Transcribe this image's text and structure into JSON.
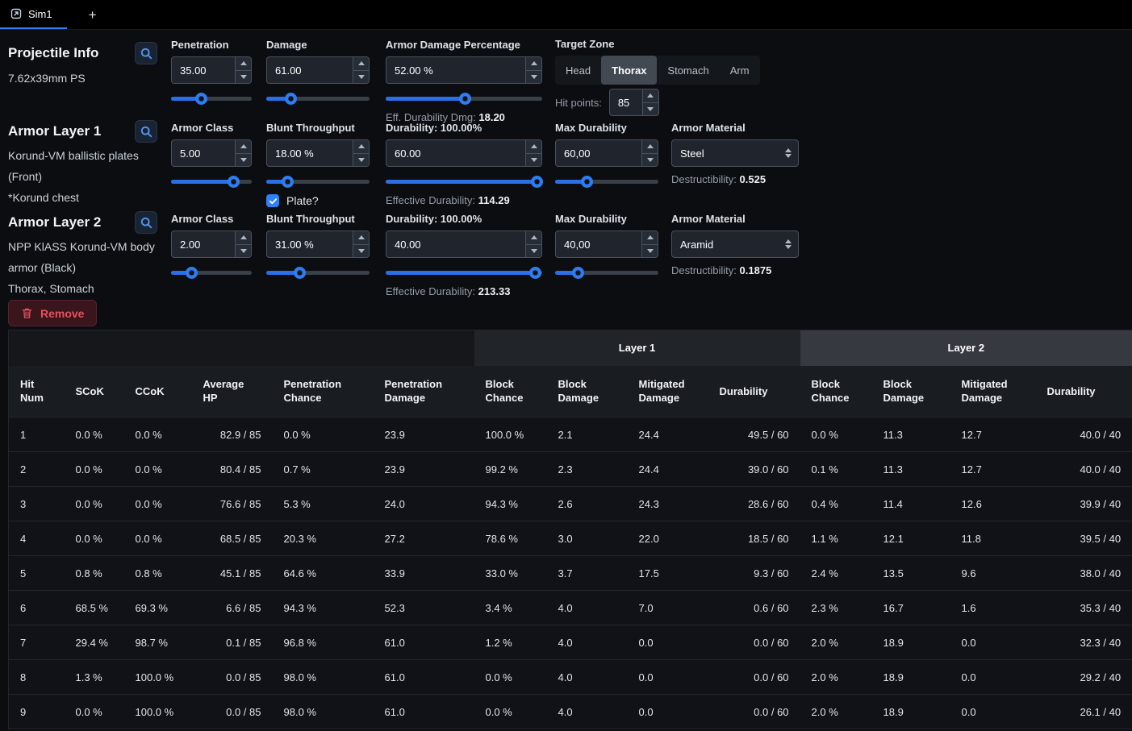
{
  "tab_bar": {
    "active_tab": "Sim1",
    "new_tab": "+"
  },
  "projectile": {
    "title": "Projectile Info",
    "name": "7.62x39mm PS",
    "penetration": {
      "label": "Penetration",
      "value": "35.00"
    },
    "damage": {
      "label": "Damage",
      "value": "61.00"
    },
    "armor_damage_pct": {
      "label": "Armor Damage Percentage",
      "value": "52.00 %"
    },
    "eff_durability": {
      "label": "Eff. Durability Dmg:",
      "value": "18.20"
    },
    "target_zone": {
      "label": "Target Zone",
      "options": [
        "Head",
        "Thorax",
        "Stomach",
        "Arm"
      ],
      "selected": "Thorax"
    },
    "hit_points": {
      "label": "Hit points:",
      "value": "85"
    }
  },
  "layer1": {
    "title": "Armor Layer 1",
    "name": "Korund-VM ballistic plates (Front)",
    "note": "*Korund chest",
    "armor_class": {
      "label": "Armor Class",
      "value": "5.00"
    },
    "blunt_throughput": {
      "label": "Blunt Throughput",
      "value": "18.00 %"
    },
    "plate_checkbox_label": "Plate?",
    "durability": {
      "label": "Durability: 100.00%",
      "value": "60.00"
    },
    "effective_durability": {
      "label": "Effective Durability:",
      "value": "114.29"
    },
    "max_durability": {
      "label": "Max Durability",
      "value": "60,00"
    },
    "material": {
      "label": "Armor Material",
      "value": "Steel"
    },
    "destructibility": {
      "label": "Destructibility:",
      "value": "0.525"
    }
  },
  "layer2": {
    "title": "Armor Layer 2",
    "name": "NPP KlASS Korund-VM body armor (Black)",
    "note": "Thorax, Stomach",
    "armor_class": {
      "label": "Armor Class",
      "value": "2.00"
    },
    "blunt_throughput": {
      "label": "Blunt Throughput",
      "value": "31.00 %"
    },
    "durability": {
      "label": "Durability: 100.00%",
      "value": "40.00"
    },
    "effective_durability": {
      "label": "Effective Durability:",
      "value": "213.33"
    },
    "max_durability": {
      "label": "Max Durability",
      "value": "40,00"
    },
    "material": {
      "label": "Armor Material",
      "value": "Aramid"
    },
    "destructibility": {
      "label": "Destructibility:",
      "value": "0.1875"
    },
    "remove_button": "Remove"
  },
  "table": {
    "group_headers": [
      "",
      "Layer 1",
      "Layer 2"
    ],
    "columns": [
      "Hit Num",
      "SCoK",
      "CCoK",
      "Average HP",
      "Penetration Chance",
      "Penetration Damage",
      "Block Chance",
      "Block Damage",
      "Mitigated Damage",
      "Durability",
      "Block Chance",
      "Block Damage",
      "Mitigated Damage",
      "Durability"
    ],
    "rows": [
      [
        "1",
        "0.0 %",
        "0.0 %",
        "82.9 / 85",
        "0.0 %",
        "23.9",
        "100.0 %",
        "2.1",
        "24.4",
        "49.5 / 60",
        "0.0 %",
        "11.3",
        "12.7",
        "40.0 / 40"
      ],
      [
        "2",
        "0.0 %",
        "0.0 %",
        "80.4 / 85",
        "0.7 %",
        "23.9",
        "99.2 %",
        "2.3",
        "24.4",
        "39.0 / 60",
        "0.1 %",
        "11.3",
        "12.7",
        "40.0 / 40"
      ],
      [
        "3",
        "0.0 %",
        "0.0 %",
        "76.6 / 85",
        "5.3 %",
        "24.0",
        "94.3 %",
        "2.6",
        "24.3",
        "28.6 / 60",
        "0.4 %",
        "11.4",
        "12.6",
        "39.9 / 40"
      ],
      [
        "4",
        "0.0 %",
        "0.0 %",
        "68.5 / 85",
        "20.3 %",
        "27.2",
        "78.6 %",
        "3.0",
        "22.0",
        "18.5 / 60",
        "1.1 %",
        "12.1",
        "11.8",
        "39.5 / 40"
      ],
      [
        "5",
        "0.8 %",
        "0.8 %",
        "45.1 / 85",
        "64.6 %",
        "33.9",
        "33.0 %",
        "3.7",
        "17.5",
        "9.3 / 60",
        "2.4 %",
        "13.5",
        "9.6",
        "38.0 / 40"
      ],
      [
        "6",
        "68.5 %",
        "69.3 %",
        "6.6 / 85",
        "94.3 %",
        "52.3",
        "3.4 %",
        "4.0",
        "7.0",
        "0.6 / 60",
        "2.3 %",
        "16.7",
        "1.6",
        "35.3 / 40"
      ],
      [
        "7",
        "29.4 %",
        "98.7 %",
        "0.1 / 85",
        "96.8 %",
        "61.0",
        "1.2 %",
        "4.0",
        "0.0",
        "0.0 / 60",
        "2.0 %",
        "18.9",
        "0.0",
        "32.3 / 40"
      ],
      [
        "8",
        "1.3 %",
        "100.0 %",
        "0.0 / 85",
        "98.0 %",
        "61.0",
        "0.0 %",
        "4.0",
        "0.0",
        "0.0 / 60",
        "2.0 %",
        "18.9",
        "0.0",
        "29.2 / 40"
      ],
      [
        "9",
        "0.0 %",
        "100.0 %",
        "0.0 / 85",
        "98.0 %",
        "61.0",
        "0.0 %",
        "4.0",
        "0.0",
        "0.0 / 60",
        "2.0 %",
        "18.9",
        "0.0",
        "26.1 / 40"
      ]
    ]
  }
}
